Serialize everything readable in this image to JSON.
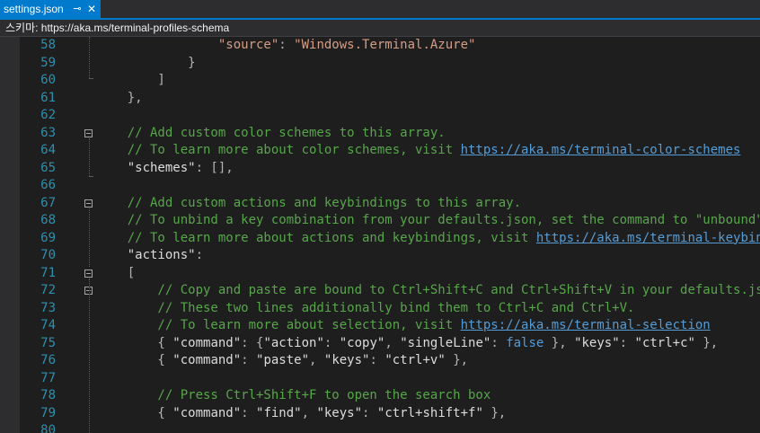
{
  "tab": {
    "title": "settings.json",
    "pin_glyph": "⊸",
    "close_glyph": "✕"
  },
  "schema_bar": {
    "text": "스키마: https://aka.ms/terminal-profiles-schema"
  },
  "colors": {
    "accent": "#007acc",
    "comment": "#57a64a",
    "string": "#d69d85",
    "keyword": "#569cd6",
    "line_number": "#2b91af",
    "background": "#1e1e1e"
  },
  "lines": [
    {
      "n": "58",
      "fold": false,
      "tokens": [
        {
          "t": "                \"source\"",
          "c": "c-key"
        },
        {
          "t": ": ",
          "c": "c-pun"
        },
        {
          "t": "\"Windows.Terminal.Azure\"",
          "c": "c-str"
        }
      ]
    },
    {
      "n": "59",
      "fold": false,
      "tokens": [
        {
          "t": "            }",
          "c": "c-pun"
        }
      ]
    },
    {
      "n": "60",
      "fold": false,
      "tokens": [
        {
          "t": "        ]",
          "c": "c-pun"
        }
      ]
    },
    {
      "n": "61",
      "fold": false,
      "tokens": [
        {
          "t": "    },",
          "c": "c-pun"
        }
      ]
    },
    {
      "n": "62",
      "fold": false,
      "tokens": []
    },
    {
      "n": "63",
      "fold": true,
      "tokens": [
        {
          "t": "    // Add custom color schemes to this array.",
          "c": "c-com"
        }
      ]
    },
    {
      "n": "64",
      "fold": false,
      "tokens": [
        {
          "t": "    // To learn more about color schemes, visit ",
          "c": "c-com"
        },
        {
          "t": "https://aka.ms/terminal-color-schemes",
          "c": "c-link"
        }
      ]
    },
    {
      "n": "65",
      "fold": false,
      "tokens": [
        {
          "t": "    \"schemes\"",
          "c": "c-dim"
        },
        {
          "t": ": [],",
          "c": "c-pun"
        }
      ]
    },
    {
      "n": "66",
      "fold": false,
      "tokens": []
    },
    {
      "n": "67",
      "fold": true,
      "tokens": [
        {
          "t": "    // Add custom actions and keybindings to this array.",
          "c": "c-com"
        }
      ]
    },
    {
      "n": "68",
      "fold": false,
      "tokens": [
        {
          "t": "    // To unbind a key combination from your defaults.json, set the command to \"unbound\".",
          "c": "c-com"
        }
      ]
    },
    {
      "n": "69",
      "fold": false,
      "tokens": [
        {
          "t": "    // To learn more about actions and keybindings, visit ",
          "c": "c-com"
        },
        {
          "t": "https://aka.ms/terminal-keybindings",
          "c": "c-link"
        }
      ]
    },
    {
      "n": "70",
      "fold": false,
      "tokens": [
        {
          "t": "    \"actions\"",
          "c": "c-dim"
        },
        {
          "t": ":",
          "c": "c-pun"
        }
      ]
    },
    {
      "n": "71",
      "fold": true,
      "tokens": [
        {
          "t": "    [",
          "c": "c-pun"
        }
      ]
    },
    {
      "n": "72",
      "fold": true,
      "tokens": [
        {
          "t": "        // Copy and paste are bound to Ctrl+Shift+C and Ctrl+Shift+V in your defaults.json.",
          "c": "c-com"
        }
      ]
    },
    {
      "n": "73",
      "fold": false,
      "tokens": [
        {
          "t": "        // These two lines additionally bind them to Ctrl+C and Ctrl+V.",
          "c": "c-com"
        }
      ]
    },
    {
      "n": "74",
      "fold": false,
      "tokens": [
        {
          "t": "        // To learn more about selection, visit ",
          "c": "c-com"
        },
        {
          "t": "https://aka.ms/terminal-selection",
          "c": "c-link"
        }
      ]
    },
    {
      "n": "75",
      "fold": false,
      "tokens": [
        {
          "t": "        { ",
          "c": "c-pun"
        },
        {
          "t": "\"command\"",
          "c": "c-dim"
        },
        {
          "t": ": {",
          "c": "c-pun"
        },
        {
          "t": "\"action\"",
          "c": "c-dim"
        },
        {
          "t": ": ",
          "c": "c-pun"
        },
        {
          "t": "\"copy\"",
          "c": "c-dim"
        },
        {
          "t": ", ",
          "c": "c-pun"
        },
        {
          "t": "\"singleLine\"",
          "c": "c-dim"
        },
        {
          "t": ": ",
          "c": "c-pun"
        },
        {
          "t": "false",
          "c": "c-kw"
        },
        {
          "t": " }, ",
          "c": "c-pun"
        },
        {
          "t": "\"keys\"",
          "c": "c-dim"
        },
        {
          "t": ": ",
          "c": "c-pun"
        },
        {
          "t": "\"ctrl+c\"",
          "c": "c-dim"
        },
        {
          "t": " },",
          "c": "c-pun"
        }
      ]
    },
    {
      "n": "76",
      "fold": false,
      "tokens": [
        {
          "t": "        { ",
          "c": "c-pun"
        },
        {
          "t": "\"command\"",
          "c": "c-dim"
        },
        {
          "t": ": ",
          "c": "c-pun"
        },
        {
          "t": "\"paste\"",
          "c": "c-dim"
        },
        {
          "t": ", ",
          "c": "c-pun"
        },
        {
          "t": "\"keys\"",
          "c": "c-dim"
        },
        {
          "t": ": ",
          "c": "c-pun"
        },
        {
          "t": "\"ctrl+v\"",
          "c": "c-dim"
        },
        {
          "t": " },",
          "c": "c-pun"
        }
      ]
    },
    {
      "n": "77",
      "fold": false,
      "tokens": []
    },
    {
      "n": "78",
      "fold": false,
      "tokens": [
        {
          "t": "        // Press Ctrl+Shift+F to open the search box",
          "c": "c-com"
        }
      ]
    },
    {
      "n": "79",
      "fold": false,
      "tokens": [
        {
          "t": "        { ",
          "c": "c-pun"
        },
        {
          "t": "\"command\"",
          "c": "c-dim"
        },
        {
          "t": ": ",
          "c": "c-pun"
        },
        {
          "t": "\"find\"",
          "c": "c-dim"
        },
        {
          "t": ", ",
          "c": "c-pun"
        },
        {
          "t": "\"keys\"",
          "c": "c-dim"
        },
        {
          "t": ": ",
          "c": "c-pun"
        },
        {
          "t": "\"ctrl+shift+f\"",
          "c": "c-dim"
        },
        {
          "t": " },",
          "c": "c-pun"
        }
      ]
    },
    {
      "n": "80",
      "fold": false,
      "tokens": []
    }
  ]
}
